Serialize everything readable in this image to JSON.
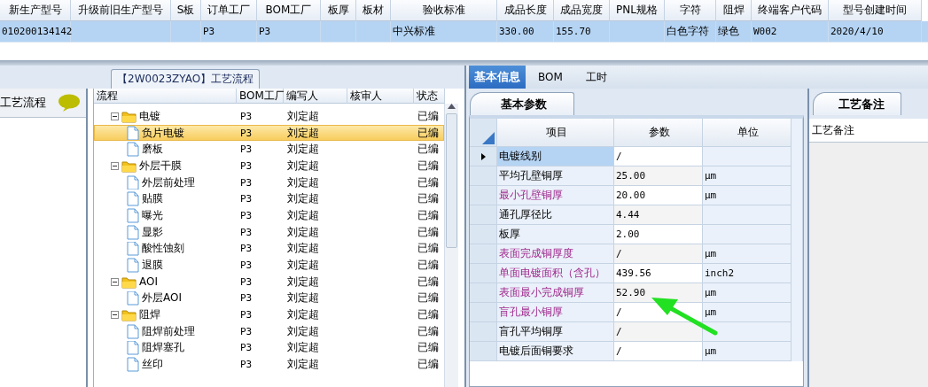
{
  "top_grid": {
    "columns": [
      "新生产型号",
      "升级前旧生产型号",
      "S板",
      "订单工厂",
      "BOM工厂",
      "板厚",
      "板材",
      "验收标准",
      "成品长度",
      "成品宽度",
      "PNL规格",
      "字符",
      "阻焊",
      "终端客户代码",
      "型号创建时间"
    ],
    "rows": [
      {
        "selected": true,
        "cells": [
          "010200134142",
          null,
          null,
          "P3",
          "P3",
          null,
          null,
          "中兴标准",
          "330.00",
          "155.70",
          null,
          "白色字符",
          "绿色",
          "W002",
          "2020/4/10"
        ]
      }
    ]
  },
  "process_panel": {
    "title": "工艺流程"
  },
  "group_title": "【2W0023ZYAO】工艺流程",
  "tree": {
    "columns": [
      "流程",
      "BOM工厂",
      "编写人",
      "核审人",
      "状态"
    ],
    "nodes": [
      {
        "kind": "folder",
        "label": "电镀",
        "bom": "P3",
        "author": "刘定超",
        "status": "已编",
        "expanded": true,
        "selected": false,
        "children": [
          {
            "kind": "file",
            "label": "负片电镀",
            "bom": "P3",
            "author": "刘定超",
            "status": "已编",
            "selected": true
          },
          {
            "kind": "file",
            "label": "磨板",
            "bom": "P3",
            "author": "刘定超",
            "status": "已编",
            "selected": false
          }
        ]
      },
      {
        "kind": "folder",
        "label": "外层干膜",
        "bom": "P3",
        "author": "刘定超",
        "status": "已编",
        "expanded": true,
        "selected": false,
        "children": [
          {
            "kind": "file",
            "label": "外层前处理",
            "bom": "P3",
            "author": "刘定超",
            "status": "已编",
            "selected": false
          },
          {
            "kind": "file",
            "label": "贴膜",
            "bom": "P3",
            "author": "刘定超",
            "status": "已编",
            "selected": false
          },
          {
            "kind": "file",
            "label": "曝光",
            "bom": "P3",
            "author": "刘定超",
            "status": "已编",
            "selected": false
          },
          {
            "kind": "file",
            "label": "显影",
            "bom": "P3",
            "author": "刘定超",
            "status": "已编",
            "selected": false
          },
          {
            "kind": "file",
            "label": "酸性蚀刻",
            "bom": "P3",
            "author": "刘定超",
            "status": "已编",
            "selected": false
          },
          {
            "kind": "file",
            "label": "退膜",
            "bom": "P3",
            "author": "刘定超",
            "status": "已编",
            "selected": false
          }
        ]
      },
      {
        "kind": "folder",
        "label": "AOI",
        "bom": "P3",
        "author": "刘定超",
        "status": "已编",
        "expanded": true,
        "selected": false,
        "children": [
          {
            "kind": "file",
            "label": "外层AOI",
            "bom": "P3",
            "author": "刘定超",
            "status": "已编",
            "selected": false
          }
        ]
      },
      {
        "kind": "folder",
        "label": "阻焊",
        "bom": "P3",
        "author": "刘定超",
        "status": "已编",
        "expanded": true,
        "selected": false,
        "children": [
          {
            "kind": "file",
            "label": "阻焊前处理",
            "bom": "P3",
            "author": "刘定超",
            "status": "已编",
            "selected": false
          },
          {
            "kind": "file",
            "label": "阻焊塞孔",
            "bom": "P3",
            "author": "刘定超",
            "status": "已编",
            "selected": false
          },
          {
            "kind": "file",
            "label": "丝印",
            "bom": "P3",
            "author": "刘定超",
            "status": "已编",
            "selected": false
          }
        ]
      }
    ]
  },
  "tabs": [
    {
      "label": "基本信息",
      "selected": true
    },
    {
      "label": "BOM",
      "selected": false
    },
    {
      "label": "工时",
      "selected": false
    }
  ],
  "sub_tab": "基本参数",
  "param_grid": {
    "columns": [
      "项目",
      "参数",
      "单位"
    ],
    "rows": [
      {
        "item": "电镀线别",
        "value": "/",
        "highlighted": false,
        "selected": true
      },
      {
        "item": "平均孔壁铜厚",
        "value": "25.00",
        "unit": "μm",
        "highlighted": false,
        "selected": false
      },
      {
        "item": "最小孔壁铜厚",
        "value": "20.00",
        "unit": "μm",
        "highlighted": true,
        "selected": false
      },
      {
        "item": "通孔厚径比",
        "value": "4.44",
        "highlighted": false,
        "selected": false
      },
      {
        "item": "板厚",
        "value": "2.00",
        "highlighted": false,
        "selected": false
      },
      {
        "item": "表面完成铜厚度",
        "value": "/",
        "unit": "μm",
        "highlighted": true,
        "selected": false
      },
      {
        "item": "单面电镀面积（含孔）",
        "value": "439.56",
        "unit": "inch2",
        "highlighted": true,
        "selected": false
      },
      {
        "item": "表面最小完成铜厚",
        "value": "52.90",
        "unit": "μm",
        "highlighted": true,
        "selected": false
      },
      {
        "item": "盲孔最小铜厚",
        "value": "/",
        "unit": "μm",
        "highlighted": true,
        "selected": false
      },
      {
        "item": "盲孔平均铜厚",
        "value": "/",
        "highlighted": false,
        "selected": false
      },
      {
        "item": "电镀后面铜要求",
        "value": "/",
        "unit": "μm",
        "highlighted": false,
        "selected": false
      }
    ]
  },
  "notes": {
    "tab": "工艺备注",
    "header": "工艺备注"
  }
}
